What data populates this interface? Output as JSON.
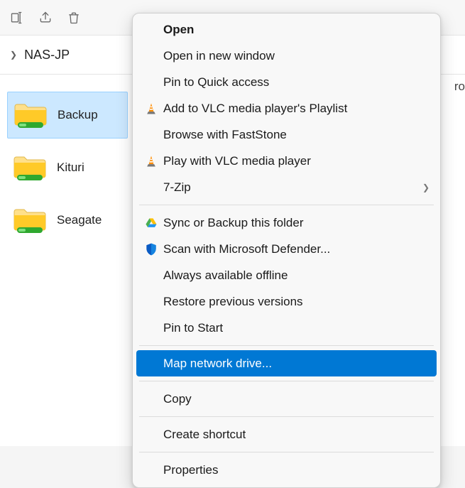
{
  "toolbar": {
    "icons": [
      "rename-icon",
      "share-icon",
      "delete-icon"
    ]
  },
  "breadcrumb": {
    "label": "NAS-JP"
  },
  "right_partial": "ro",
  "folders": [
    {
      "name": "Backup",
      "selected": true
    },
    {
      "name": "Kituri",
      "selected": false
    },
    {
      "name": "Seagate",
      "selected": false
    }
  ],
  "menu": {
    "groups": [
      [
        {
          "id": "open",
          "label": "Open",
          "icon": null,
          "bold": true
        },
        {
          "id": "open-new-window",
          "label": "Open in new window",
          "icon": null
        },
        {
          "id": "pin-quick-access",
          "label": "Pin to Quick access",
          "icon": null
        },
        {
          "id": "vlc-playlist",
          "label": "Add to VLC media player's Playlist",
          "icon": "vlc"
        },
        {
          "id": "faststone",
          "label": "Browse with FastStone",
          "icon": null
        },
        {
          "id": "vlc-play",
          "label": "Play with VLC media player",
          "icon": "vlc"
        },
        {
          "id": "7zip",
          "label": "7-Zip",
          "icon": null,
          "submenu": true
        }
      ],
      [
        {
          "id": "google-sync",
          "label": "Sync or Backup this folder",
          "icon": "gdrive"
        },
        {
          "id": "defender",
          "label": "Scan with Microsoft Defender...",
          "icon": "shield"
        },
        {
          "id": "offline",
          "label": "Always available offline",
          "icon": null
        },
        {
          "id": "restore",
          "label": "Restore previous versions",
          "icon": null
        },
        {
          "id": "pin-start",
          "label": "Pin to Start",
          "icon": null
        }
      ],
      [
        {
          "id": "map-drive",
          "label": "Map network drive...",
          "icon": null,
          "selected": true
        }
      ],
      [
        {
          "id": "copy",
          "label": "Copy",
          "icon": null
        }
      ],
      [
        {
          "id": "shortcut",
          "label": "Create shortcut",
          "icon": null
        }
      ],
      [
        {
          "id": "properties",
          "label": "Properties",
          "icon": null
        }
      ]
    ]
  }
}
